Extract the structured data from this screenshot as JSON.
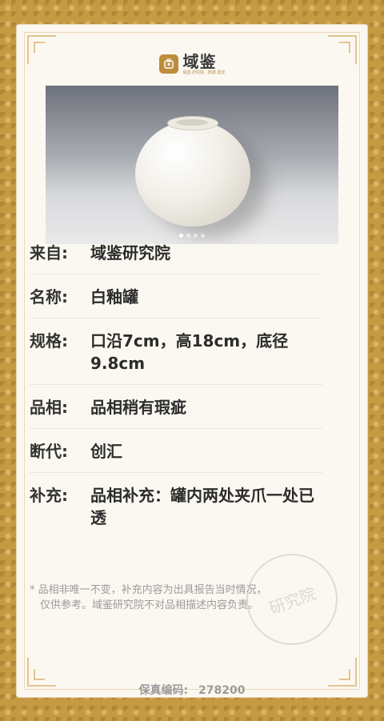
{
  "brand": {
    "name": "域鉴",
    "subtitle": "域鉴·研究院 · 数据·鉴定"
  },
  "photo": {
    "alt": "白釉罐",
    "carousel_count": 4,
    "active_index": 0
  },
  "info": {
    "rows": [
      {
        "label": "来自:",
        "value": "域鉴研究院"
      },
      {
        "label": "名称:",
        "value": "白釉罐"
      },
      {
        "label": "规格:",
        "value": "口沿7cm，高18cm，底径9.8cm"
      },
      {
        "label": "品相:",
        "value": "品相稍有瑕疵"
      },
      {
        "label": "断代:",
        "value": "创汇"
      },
      {
        "label": "补充:",
        "value": "品相补充：罐内两处夹爪一处已透"
      }
    ]
  },
  "footnote": {
    "line1": "* 品相非唯一不变，补充内容为出具报告当时情况，",
    "line2": "仅供参考。域鉴研究院不对品相描述内容负责。"
  },
  "serial": {
    "label": "保真编码:",
    "value": "278200"
  },
  "stamp": {
    "text": "研究院"
  },
  "colors": {
    "background_gold": "#c69a42",
    "card": "#fbf8f1",
    "brand_accent": "#bd8d3b"
  }
}
